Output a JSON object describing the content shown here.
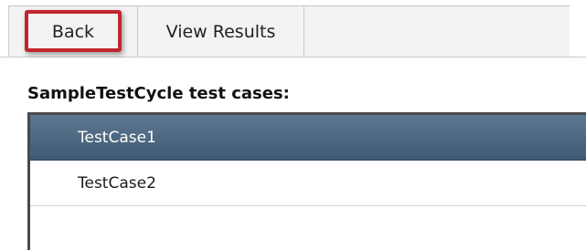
{
  "toolbar": {
    "back_label": "Back",
    "view_results_label": "View Results"
  },
  "section": {
    "title": "SampleTestCycle test cases:"
  },
  "test_cases": [
    {
      "name": "TestCase1",
      "selected": true
    },
    {
      "name": "TestCase2",
      "selected": false
    }
  ],
  "colors": {
    "highlight": "#c0272d",
    "selected_row": "#4a6680"
  }
}
